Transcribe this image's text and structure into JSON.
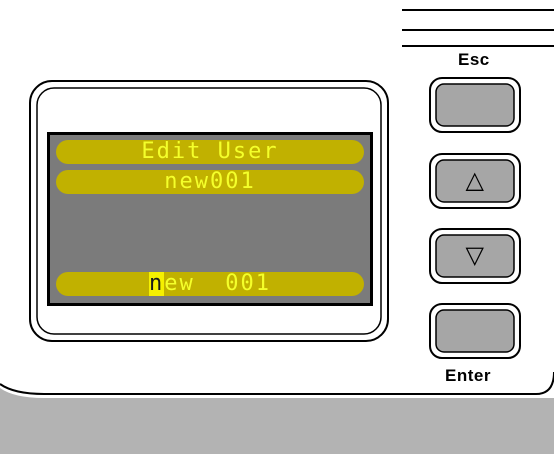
{
  "device": {
    "buttons": {
      "esc_label": "Esc",
      "up_symbol": "△",
      "down_symbol": "▽",
      "enter_label": "Enter"
    },
    "display": {
      "title": "Edit User",
      "subtitle": "new001",
      "edit_field": {
        "cursor_char": "n",
        "rest": "ew  001"
      }
    },
    "colors": {
      "lcd_background": "#7b7b7b",
      "bar_fill": "#c1b100",
      "bar_text": "#f4ff2a",
      "cursor_highlight": "#f5f000",
      "button_fill": "#a6a6a6",
      "bottom_panel": "#b3b3b3"
    }
  }
}
